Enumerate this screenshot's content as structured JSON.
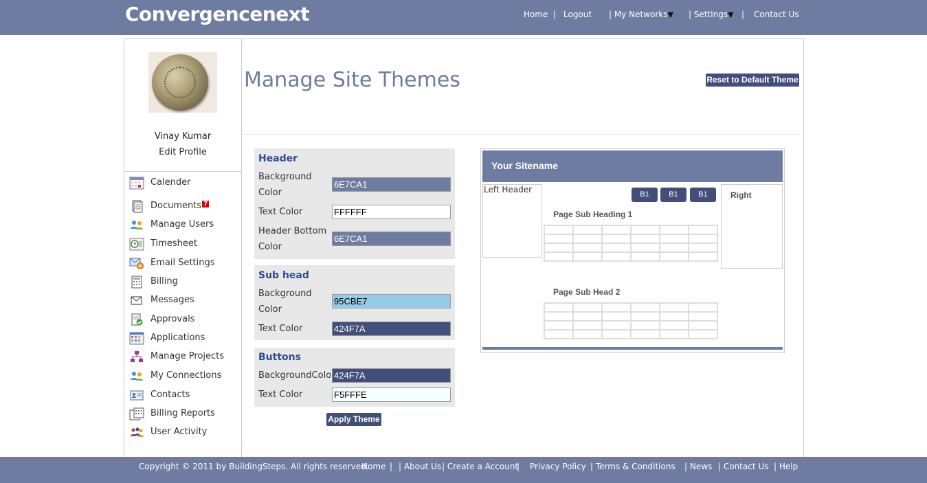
{
  "header": {
    "brand": "Convergencenext",
    "nav": {
      "home": "Home",
      "sep1": "|",
      "logout": "Logout",
      "my_networks": "| My Networks",
      "settings": "| Settings",
      "sep2": "|",
      "contact_us": "Contact Us",
      "caret": "▼"
    },
    "bg_color": "#6E7CA1"
  },
  "sidebar": {
    "user_name": "Vinay Kumar",
    "edit_profile": "Edit Profile",
    "items": [
      {
        "label": "Calender",
        "icon": "calendar-icon"
      },
      {
        "label": "Documents",
        "icon": "documents-icon",
        "badge": "7"
      },
      {
        "label": "Manage Users",
        "icon": "users-icon"
      },
      {
        "label": "Timesheet",
        "icon": "clock-icon"
      },
      {
        "label": "Email Settings",
        "icon": "email-gear-icon"
      },
      {
        "label": "Billing",
        "icon": "billing-icon"
      },
      {
        "label": "Messages",
        "icon": "envelope-icon"
      },
      {
        "label": "Approvals",
        "icon": "approval-icon"
      },
      {
        "label": "Applications",
        "icon": "applications-icon"
      },
      {
        "label": "Manage Projects",
        "icon": "projects-icon"
      },
      {
        "label": "My Connections",
        "icon": "connections-icon"
      },
      {
        "label": "Contacts",
        "icon": "contacts-icon"
      },
      {
        "label": "Billing Reports",
        "icon": "billing-reports-icon"
      },
      {
        "label": "User Activity",
        "icon": "user-activity-icon"
      }
    ]
  },
  "main": {
    "title": "Manage Site Themes",
    "reset_button": "Reset to Default Theme",
    "apply_button": "Apply Theme",
    "header_panel": {
      "title": "Header",
      "bg_label_1": "Background",
      "bg_label_2": "Color",
      "bg_value": "6E7CA1",
      "text_label": "Text Color",
      "text_value": "FFFFFF",
      "bottom_label_1": "Header Bottom",
      "bottom_label_2": "Color",
      "bottom_value": "6E7CA1"
    },
    "subhead_panel": {
      "title": "Sub head",
      "bg_label_1": "Background",
      "bg_label_2": "Color",
      "bg_value": "95CBE7",
      "text_label": "Text Color",
      "text_value": "424F7A"
    },
    "buttons_panel": {
      "title": "Buttons",
      "bg_label": "BackgroundColor",
      "bg_value": "424F7A",
      "text_label": "Text Color",
      "text_value": "F5FFFE"
    }
  },
  "preview": {
    "sitename": "Your Sitename",
    "left_header": "Left Header",
    "right_label": "Right",
    "buttons": [
      "B1",
      "B1",
      "B1"
    ],
    "sub_heading_1": "Page Sub Heading 1",
    "sub_heading_2": "Page Sub Head 2"
  },
  "footer": {
    "copyright": "Copyright © 2011 by BuildingSteps. All rights reserved.",
    "home": "Home",
    "about": "|  About Us",
    "create": "|  Create a Account",
    "privacy": "|  Privacy Policy",
    "terms": "|  Terms & Conditions",
    "news": "|  News",
    "contact": "|  Contact Us",
    "help": "|  Help",
    "sep": "|"
  },
  "colors": {
    "header_bg": "#6E7CA1",
    "header_text": "#FFFFFF",
    "subhead_bg": "#95CBE7",
    "subhead_text": "#424F7A",
    "button_bg": "#424F7A",
    "button_text": "#F5FFFE"
  }
}
